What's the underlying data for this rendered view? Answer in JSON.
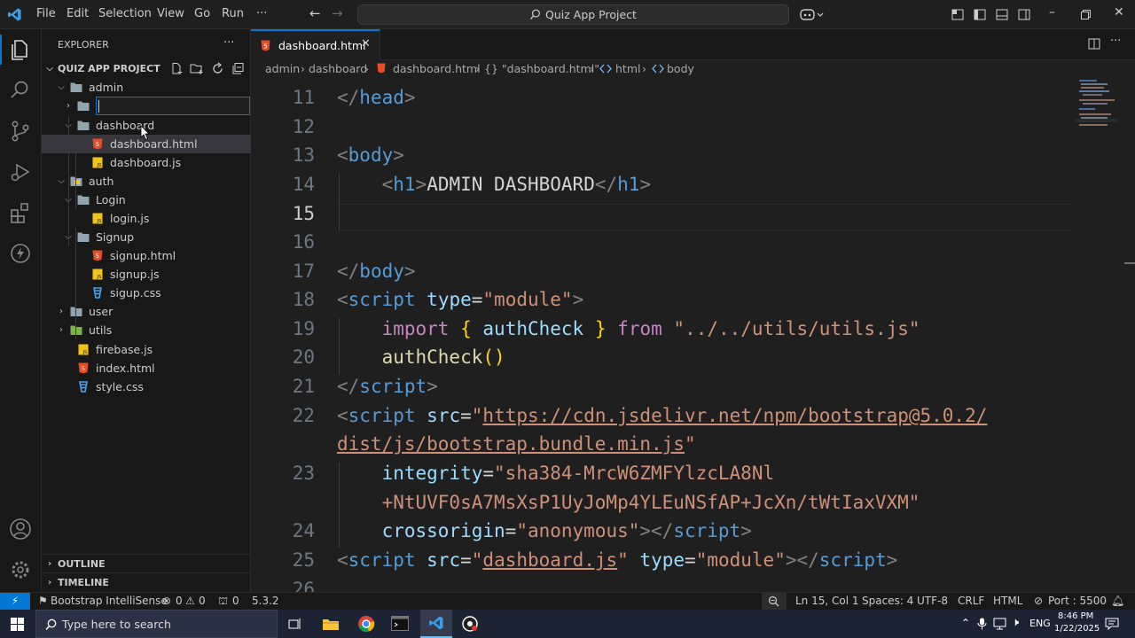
{
  "titlebar": {
    "menu": [
      "File",
      "Edit",
      "Selection",
      "View",
      "Go",
      "Run",
      "···"
    ],
    "search": "Quiz App Project"
  },
  "sidebar": {
    "title": "EXPLORER",
    "more": "···",
    "project": "QUIZ APP PROJECT",
    "tree": [
      {
        "label": "admin",
        "kind": "folder",
        "open": true
      },
      {
        "label": "",
        "kind": "folder-rename",
        "open": false
      },
      {
        "label": "dashboard",
        "kind": "folder",
        "open": true
      },
      {
        "label": "dashboard.html",
        "kind": "html"
      },
      {
        "label": "dashboard.js",
        "kind": "js"
      },
      {
        "label": "auth",
        "kind": "folder",
        "open": true
      },
      {
        "label": "Login",
        "kind": "folder",
        "open": true
      },
      {
        "label": "login.js",
        "kind": "js"
      },
      {
        "label": "Signup",
        "kind": "folder",
        "open": true
      },
      {
        "label": "signup.html",
        "kind": "html"
      },
      {
        "label": "signup.js",
        "kind": "js"
      },
      {
        "label": "sigup.css",
        "kind": "css"
      },
      {
        "label": "user",
        "kind": "folder",
        "open": false
      },
      {
        "label": "utils",
        "kind": "folder",
        "open": false
      },
      {
        "label": "firebase.js",
        "kind": "js"
      },
      {
        "label": "index.html",
        "kind": "html"
      },
      {
        "label": "style.css",
        "kind": "css"
      }
    ],
    "outline": "OUTLINE",
    "timeline": "TIMELINE"
  },
  "editor": {
    "tab": "dashboard.html",
    "breadcrumbs": [
      "admin",
      "dashboard",
      "dashboard.html",
      "{} \"dashboard.html\"",
      "html",
      "body"
    ],
    "line_numbers": [
      "11",
      "12",
      "13",
      "14",
      "15",
      "16",
      "17",
      "18",
      "19",
      "20",
      "21",
      "22",
      "",
      "23",
      "",
      "24",
      "25",
      "26"
    ],
    "current_line": "15"
  },
  "statusbar": {
    "remote": "⚡",
    "bootstrap": "Bootstrap IntelliSense",
    "errors": "0",
    "warnings": "0",
    "ports": "0",
    "version": "5.3.2",
    "position": "Ln 15, Col 1",
    "spaces": "Spaces: 4",
    "encoding": "UTF-8",
    "eol": "CRLF",
    "language": "HTML",
    "port": "Port : 5500"
  },
  "taskbar": {
    "search": "Type here to search",
    "lang": "ENG",
    "time": "8:46 PM",
    "date": "1/22/2025"
  },
  "colors": {
    "accent": "#0078d4",
    "html_icon": "#e44d26",
    "js_icon": "#f0c419",
    "css_icon": "#42a5f5",
    "folder": "#90a4ae"
  }
}
